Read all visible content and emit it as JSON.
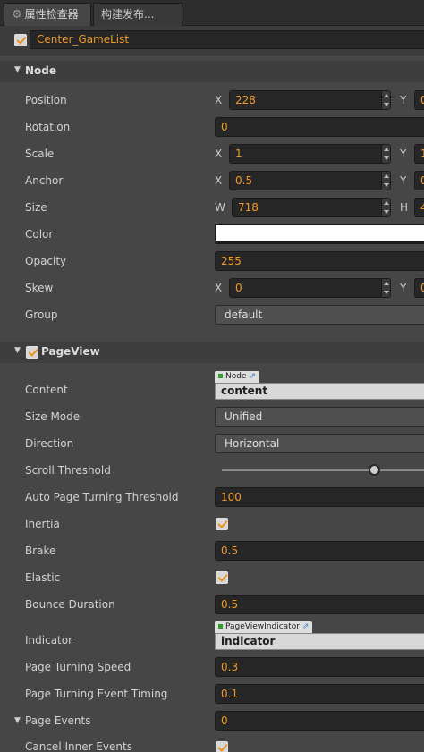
{
  "tabs": [
    {
      "label": "属性检查器",
      "icon": "gear-icon"
    },
    {
      "label": "构建发布..."
    }
  ],
  "node_name": "Center_GameList",
  "sections": {
    "node": "Node",
    "pageview": "PageView"
  },
  "node": {
    "position": {
      "label": "Position",
      "x_axis": "X",
      "x": "228",
      "y_axis": "Y",
      "y": "0"
    },
    "rotation": {
      "label": "Rotation",
      "value": "0"
    },
    "scale": {
      "label": "Scale",
      "x_axis": "X",
      "x": "1",
      "y_axis": "Y",
      "y": "1"
    },
    "anchor": {
      "label": "Anchor",
      "x_axis": "X",
      "x": "0.5",
      "y_axis": "Y",
      "y": "0"
    },
    "size": {
      "label": "Size",
      "w_axis": "W",
      "w": "718",
      "h_axis": "H",
      "h": "4"
    },
    "color": {
      "label": "Color",
      "value": "#ffffff"
    },
    "opacity": {
      "label": "Opacity",
      "value": "255"
    },
    "skew": {
      "label": "Skew",
      "x_axis": "X",
      "x": "0",
      "y_axis": "Y",
      "y": "0"
    },
    "group": {
      "label": "Group",
      "value": "default"
    }
  },
  "pageview": {
    "content": {
      "label": "Content",
      "type_tag": "Node",
      "value": "content"
    },
    "size_mode": {
      "label": "Size Mode",
      "value": "Unified"
    },
    "direction": {
      "label": "Direction",
      "value": "Horizontal"
    },
    "scroll_threshold": {
      "label": "Scroll Threshold",
      "value_fraction": 0.72
    },
    "auto_page_turning_threshold": {
      "label": "Auto Page Turning Threshold",
      "value": "100"
    },
    "inertia": {
      "label": "Inertia",
      "checked": true
    },
    "brake": {
      "label": "Brake",
      "value": "0.5"
    },
    "elastic": {
      "label": "Elastic",
      "checked": true
    },
    "bounce_duration": {
      "label": "Bounce Duration",
      "value": "0.5"
    },
    "indicator": {
      "label": "Indicator",
      "type_tag": "PageViewIndicator",
      "value": "indicator"
    },
    "page_turning_speed": {
      "label": "Page Turning Speed",
      "value": "0.3"
    },
    "page_turning_event_timing": {
      "label": "Page Turning Event Timing",
      "value": "0.1"
    },
    "page_events": {
      "label": "Page Events",
      "value": "0"
    },
    "cancel_inner_events": {
      "label": "Cancel Inner Events",
      "checked": true
    }
  },
  "colors": {
    "accent": "#f09a2b",
    "panel": "#464646",
    "field": "#262626"
  }
}
